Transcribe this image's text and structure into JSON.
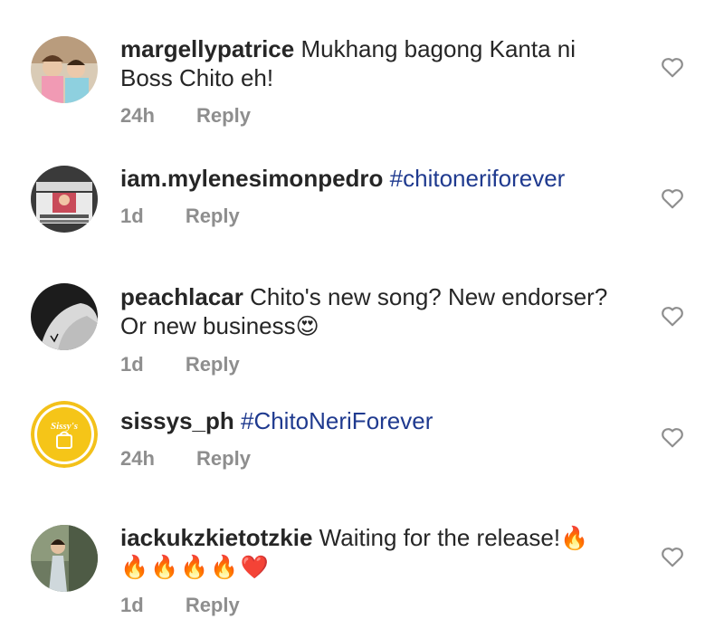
{
  "comments": [
    {
      "username": "margellypatrice",
      "text": "Mukhang bagong Kanta ni Boss Chito eh!",
      "time": "24h",
      "reply": "Reply",
      "like_icon": "heart-outline-icon"
    },
    {
      "username": "iam.mylenesimonpedro",
      "hashtag": "#chitoneriforever",
      "time": "1d",
      "reply": "Reply",
      "like_icon": "heart-outline-icon"
    },
    {
      "username": "peachlacar",
      "text": "Chito's new song? New endorser? Or new business",
      "emoji": "😍",
      "time": "1d",
      "reply": "Reply",
      "like_icon": "heart-outline-icon"
    },
    {
      "username": "sissys_ph",
      "hashtag": "#ChitoNeriForever",
      "avatar_text": "Sissy's",
      "time": "24h",
      "reply": "Reply",
      "like_icon": "heart-outline-icon"
    },
    {
      "username": "iackukzkietotzkie",
      "text": "Waiting for the release!",
      "emoji": "🔥",
      "emoji_line": "🔥🔥🔥🔥❤️",
      "time": "1d",
      "reply": "Reply",
      "like_icon": "heart-outline-icon"
    }
  ],
  "colors": {
    "text": "#262626",
    "meta": "#8e8e8e",
    "hashtag": "#1f3a8f",
    "sissys_ring": "#f1c40f"
  }
}
